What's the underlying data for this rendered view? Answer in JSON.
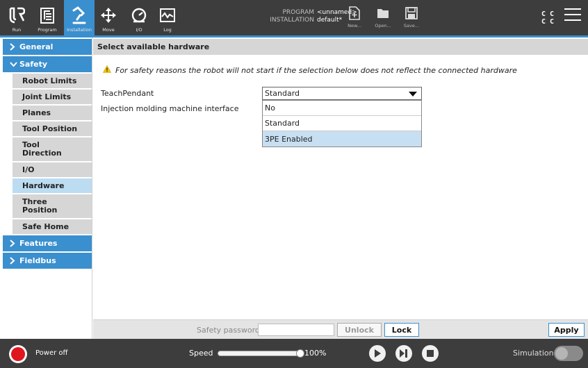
{
  "toolbar": {
    "run_label": "Run",
    "program_label": "Program",
    "installation_label": "Installation",
    "move_label": "Move",
    "io_label": "I/O",
    "log_label": "Log",
    "program_key": "PROGRAM",
    "program_value": "<unnamed>",
    "installation_key": "INSTALLATION",
    "installation_value": "default*",
    "new_label": "New...",
    "open_label": "Open...",
    "save_label": "Save...",
    "cc_line1": "C C",
    "cc_line2": "C C",
    "accent_color": "#3a8fce"
  },
  "sidebar": {
    "general": "General",
    "safety": "Safety",
    "items": [
      {
        "label": "Robot Limits"
      },
      {
        "label": "Joint Limits"
      },
      {
        "label": "Planes"
      },
      {
        "label": "Tool Position"
      },
      {
        "label": "Tool Direction"
      },
      {
        "label": "I/O"
      },
      {
        "label": "Hardware"
      },
      {
        "label": "Three Position"
      },
      {
        "label": "Safe Home"
      }
    ],
    "features": "Features",
    "fieldbus": "Fieldbus",
    "selected": "Hardware"
  },
  "main": {
    "title": "Select available hardware",
    "warning": "For safety reasons the robot will not start if the selection below does not reflect the connected hardware",
    "teach_pendant_label": "TeachPendant",
    "injection_label": "Injection molding machine interface",
    "dropdown_value": "Standard",
    "dropdown_options": [
      "No",
      "Standard",
      "3PE Enabled"
    ],
    "highlighted_option": "3PE Enabled",
    "password_label": "Safety password",
    "unlock_label": "Unlock",
    "lock_label": "Lock",
    "apply_label": "Apply"
  },
  "footer": {
    "power_label": "Power off",
    "speed_label": "Speed",
    "speed_value": "100%",
    "speed_fraction": 1.0,
    "simulation_label": "Simulation",
    "simulation_on": false
  }
}
